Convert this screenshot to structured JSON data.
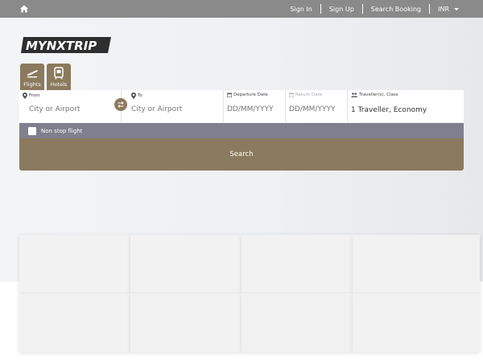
{
  "topbar": {
    "home_icon": "home-icon",
    "nav": {
      "sign_in": "Sign In",
      "sign_up": "Sign Up",
      "search_booking": "Search Booking",
      "currency": "INR"
    }
  },
  "brand": {
    "logo_text": "MYNXTRIP"
  },
  "tabs": [
    {
      "label": "Flights",
      "icon": "plane-icon"
    },
    {
      "label": "Hotels",
      "icon": "hotel-icon"
    }
  ],
  "search_form": {
    "from": {
      "label": "From",
      "placeholder": "City or Airport",
      "icon": "map-pin-icon"
    },
    "swap_icon": "swap-icon",
    "to": {
      "label": "To",
      "placeholder": "City or Airport",
      "icon": "map-pin-icon"
    },
    "departure": {
      "label": "Departure Date",
      "placeholder": "DD/MM/YYYY",
      "icon": "calendar-icon"
    },
    "return": {
      "label": "Return Date",
      "placeholder": "DD/MM/YYYY",
      "icon": "calendar-icon"
    },
    "travellers": {
      "label": "Traveller(s), Class",
      "value": "1 Traveller, Economy",
      "icon": "users-icon"
    },
    "non_stop_label": "Non stop flight",
    "search_label": "Search"
  },
  "colors": {
    "accent": "#8b7a5e",
    "topbar": "#8a8a8a",
    "nonstop_bar": "#7f7f8d"
  }
}
